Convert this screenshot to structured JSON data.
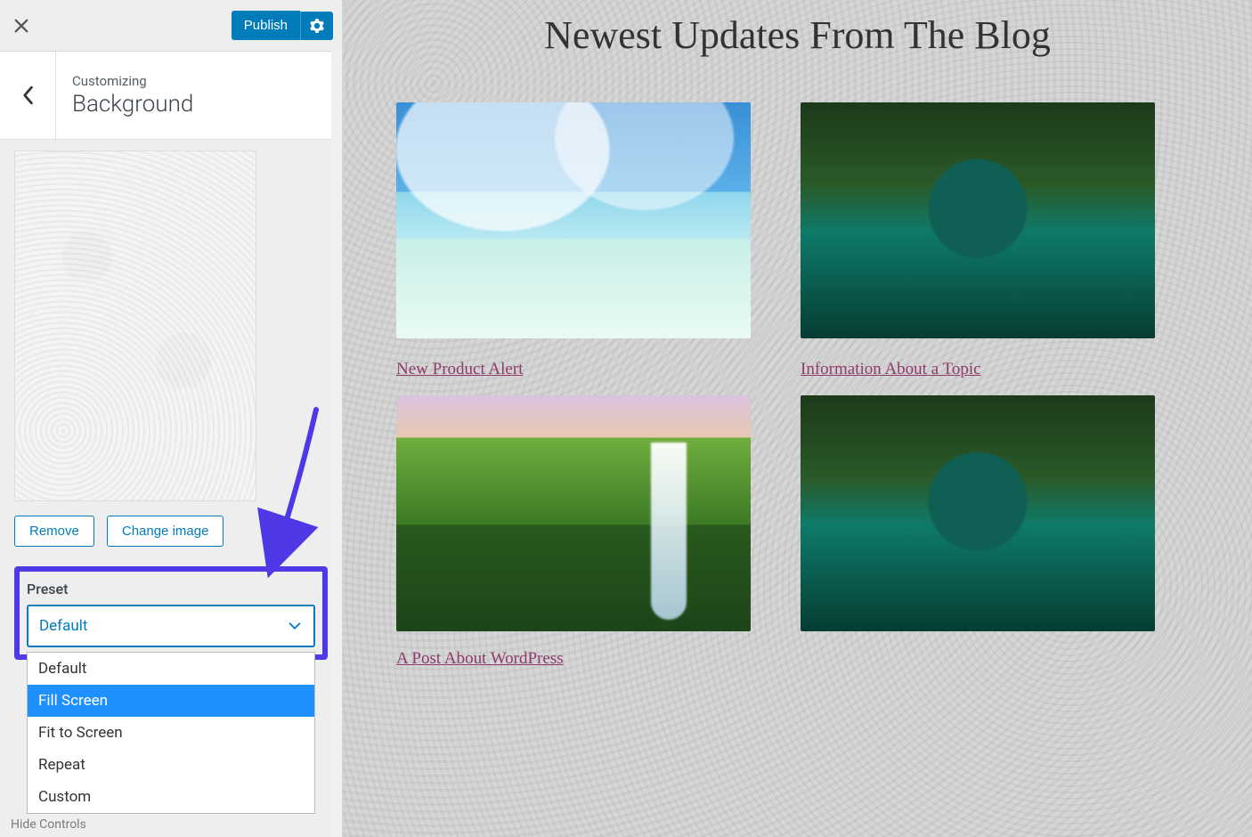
{
  "header": {
    "publish_label": "Publish"
  },
  "section": {
    "breadcrumb": "Customizing",
    "title": "Background"
  },
  "buttons": {
    "remove": "Remove",
    "change_image": "Change image"
  },
  "preset": {
    "label": "Preset",
    "selected": "Default",
    "options": [
      "Default",
      "Fill Screen",
      "Fit to Screen",
      "Repeat",
      "Custom"
    ],
    "highlighted_index": 1
  },
  "footer": {
    "hide_controls": "Hide Controls"
  },
  "preview": {
    "page_title": "Newest Updates From The Blog",
    "posts": [
      {
        "title": "New Product Alert"
      },
      {
        "title": "Information About a Topic"
      },
      {
        "title": "A Post About WordPress"
      }
    ]
  },
  "colors": {
    "primary": "#007cba",
    "annotation": "#4f39e6",
    "link": "#8e3a6d"
  }
}
